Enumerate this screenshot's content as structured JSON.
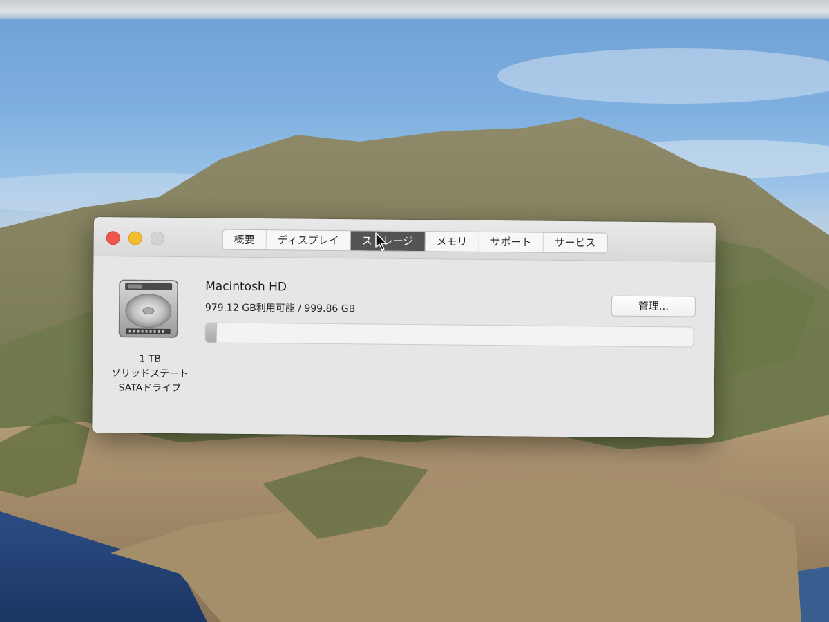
{
  "window": {
    "tabs": [
      {
        "label": "概要",
        "active": false
      },
      {
        "label": "ディスプレイ",
        "active": false
      },
      {
        "label": "ストレージ",
        "active": true
      },
      {
        "label": "メモリ",
        "active": false
      },
      {
        "label": "サポート",
        "active": false
      },
      {
        "label": "サービス",
        "active": false
      }
    ]
  },
  "drive": {
    "capacity": "1 TB",
    "type": "ソリッドステート",
    "interface": "SATAドライブ",
    "icon": "hard-drive-icon"
  },
  "volume": {
    "name": "Macintosh HD",
    "capacity_text": "979.12 GB利用可能 / 999.86 GB",
    "available_gb": 979.12,
    "total_gb": 999.86,
    "manage_label": "管理..."
  },
  "colors": {
    "close": "#f0564d",
    "minimize": "#f3bc33",
    "zoom": "#d3d3d3",
    "active_tab": "#545454"
  }
}
